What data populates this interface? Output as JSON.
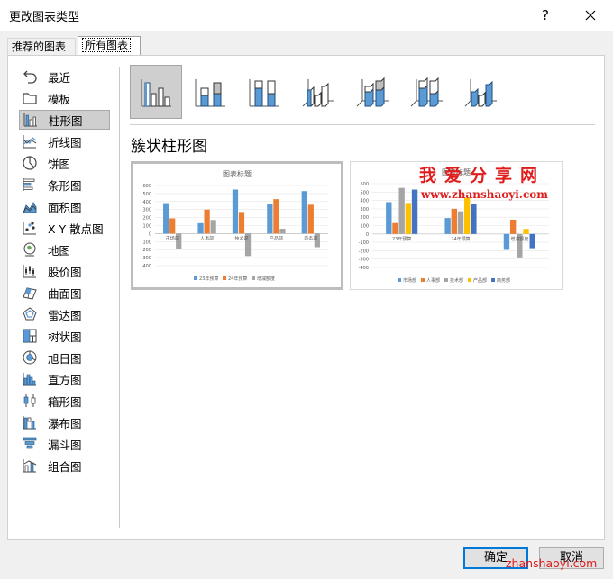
{
  "window": {
    "title": "更改图表类型",
    "help_label": "?"
  },
  "tabs": [
    {
      "label": "推荐的图表"
    },
    {
      "label": "所有图表"
    }
  ],
  "categories": [
    {
      "label": "最近",
      "icon": "undo-icon"
    },
    {
      "label": "模板",
      "icon": "folder-icon"
    },
    {
      "label": "柱形图",
      "icon": "column-chart-icon",
      "selected": true
    },
    {
      "label": "折线图",
      "icon": "line-chart-icon"
    },
    {
      "label": "饼图",
      "icon": "pie-chart-icon"
    },
    {
      "label": "条形图",
      "icon": "bar-chart-icon"
    },
    {
      "label": "面积图",
      "icon": "area-chart-icon"
    },
    {
      "label": "X Y 散点图",
      "icon": "scatter-chart-icon"
    },
    {
      "label": "地图",
      "icon": "map-chart-icon"
    },
    {
      "label": "股价图",
      "icon": "stock-chart-icon"
    },
    {
      "label": "曲面图",
      "icon": "surface-chart-icon"
    },
    {
      "label": "雷达图",
      "icon": "radar-chart-icon"
    },
    {
      "label": "树状图",
      "icon": "treemap-chart-icon"
    },
    {
      "label": "旭日图",
      "icon": "sunburst-chart-icon"
    },
    {
      "label": "直方图",
      "icon": "histogram-chart-icon"
    },
    {
      "label": "箱形图",
      "icon": "box-whisker-chart-icon"
    },
    {
      "label": "瀑布图",
      "icon": "waterfall-chart-icon"
    },
    {
      "label": "漏斗图",
      "icon": "funnel-chart-icon"
    },
    {
      "label": "组合图",
      "icon": "combo-chart-icon"
    }
  ],
  "subtype_heading": "簇状柱形图",
  "watermark": {
    "text": "我爱分享网",
    "url": "www.zhanshaoyi.com",
    "footer": "zhanshaoyi.com"
  },
  "buttons": {
    "ok": "确定",
    "cancel": "取消"
  },
  "colors": {
    "blue": "#5b9bd5",
    "orange": "#ed7d31",
    "gray": "#a5a5a5",
    "yellow": "#ffc000",
    "darkblue": "#4472c4",
    "selected_bg": "#cfcfcf",
    "accent": "#0078d7",
    "watermark": "#e01d1d"
  },
  "chart_data": [
    {
      "type": "bar",
      "title": "图表标题",
      "categories": [
        "市场部",
        "人事部",
        "技术部",
        "产品部",
        "商务部"
      ],
      "series": [
        {
          "name": "23年预算",
          "values": [
            380,
            130,
            550,
            370,
            530
          ]
        },
        {
          "name": "24年预算",
          "values": [
            190,
            300,
            270,
            430,
            360
          ]
        },
        {
          "name": "增减额度",
          "values": [
            -190,
            170,
            -280,
            60,
            -170
          ]
        }
      ],
      "ylim": [
        -400,
        600
      ],
      "yticks": [
        600,
        500,
        400,
        300,
        200,
        100,
        0,
        -100,
        -200,
        -300,
        -400
      ],
      "grid": true,
      "legend": "bottom"
    },
    {
      "type": "bar",
      "title": "图表标题",
      "categories": [
        "23年预算",
        "24年预算",
        "增减额度"
      ],
      "series": [
        {
          "name": "市场部",
          "values": [
            380,
            190,
            -190
          ]
        },
        {
          "name": "人事部",
          "values": [
            130,
            300,
            170
          ]
        },
        {
          "name": "技术部",
          "values": [
            550,
            270,
            -280
          ]
        },
        {
          "name": "产品部",
          "values": [
            370,
            430,
            60
          ]
        },
        {
          "name": "商务部",
          "values": [
            530,
            360,
            -170
          ]
        }
      ],
      "ylim": [
        -400,
        600
      ],
      "yticks": [
        600,
        500,
        400,
        300,
        200,
        100,
        0,
        -100,
        -200,
        -300,
        -400
      ],
      "grid": true,
      "legend": "bottom"
    }
  ]
}
